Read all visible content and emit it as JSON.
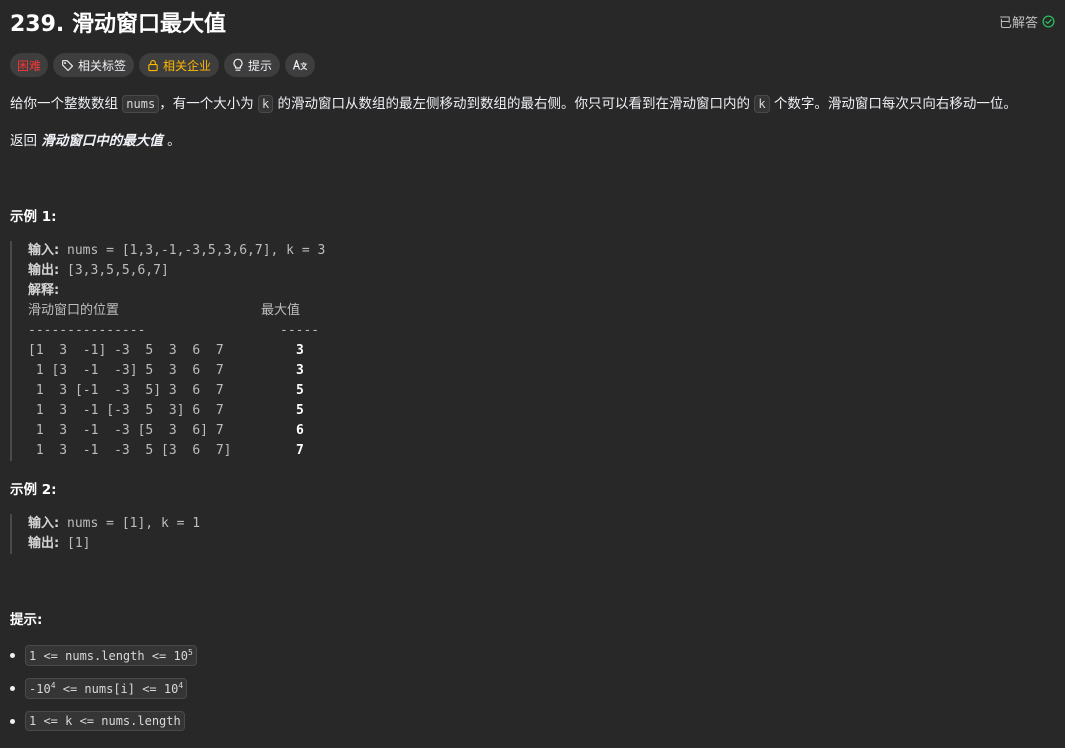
{
  "problem": {
    "title": "239. 滑动窗口最大值",
    "status_label": "已解答",
    "colors": {
      "solved": "#2cbb5d",
      "hard": "#f63636",
      "company": "#ffb800"
    }
  },
  "tags": {
    "difficulty": "困难",
    "topics": "相关标签",
    "companies": "相关企业",
    "hint": "提示",
    "translate_icon": "translate-icon"
  },
  "description": {
    "p1_a": "给你一个整数数组 ",
    "p1_code1": "nums",
    "p1_b": "，有一个大小为 ",
    "p1_code2": "k",
    "p1_c": " 的滑动窗口从数组的最左侧移动到数组的最右侧。你只可以看到在滑动窗口内的 ",
    "p1_code3": "k",
    "p1_d": " 个数字。滑动窗口每次只向右移动一位。",
    "p2_a": "返回 ",
    "p2_em": "滑动窗口中的最大值",
    "p2_b": " 。"
  },
  "example1": {
    "heading": "示例 1:",
    "input_label": "输入:",
    "input_value": " nums = [1,3,-1,-3,5,3,6,7], k = 3",
    "output_label": "输出:",
    "output_value": " [3,3,5,5,6,7]",
    "explain_label": "解释:",
    "col_window": "滑动窗口的位置",
    "col_max": "最大值",
    "sep_window": "---------------",
    "sep_max": "-----",
    "rows": [
      {
        "window": "[1  3  -1] -3  5  3  6  7",
        "max": "3"
      },
      {
        "window": " 1 [3  -1  -3] 5  3  6  7",
        "max": "3"
      },
      {
        "window": " 1  3 [-1  -3  5] 3  6  7",
        "max": "5"
      },
      {
        "window": " 1  3  -1 [-3  5  3] 6  7",
        "max": "5"
      },
      {
        "window": " 1  3  -1  -3 [5  3  6] 7",
        "max": "6"
      },
      {
        "window": " 1  3  -1  -3  5 [3  6  7]",
        "max": "7"
      }
    ]
  },
  "example2": {
    "heading": "示例 2:",
    "input_label": "输入:",
    "input_value": " nums = [1], k = 1",
    "output_label": "输出:",
    "output_value": " [1]"
  },
  "constraints": {
    "heading": "提示:",
    "c1_text": "1 <= nums.length <= 10",
    "c1_sup": "5",
    "c2_pre": "-10",
    "c2_sup1": "4",
    "c2_mid": " <= nums[i] <= 10",
    "c2_sup2": "4",
    "c3_text": "1 <= k <= nums.length"
  }
}
